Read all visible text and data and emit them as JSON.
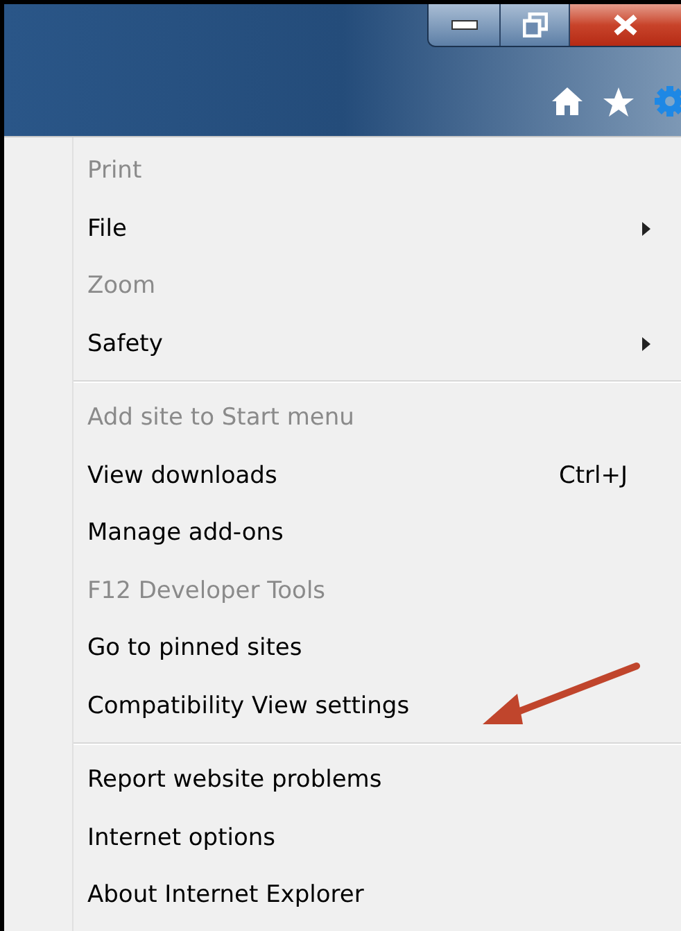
{
  "menu": {
    "sections": [
      {
        "items": [
          {
            "label": "Print",
            "disabled": true,
            "submenu": false
          },
          {
            "label": "File",
            "disabled": false,
            "submenu": true
          },
          {
            "label": "Zoom",
            "disabled": true,
            "submenu": false
          },
          {
            "label": "Safety",
            "disabled": false,
            "submenu": true
          }
        ]
      },
      {
        "items": [
          {
            "label": "Add site to Start menu",
            "disabled": true,
            "submenu": false
          },
          {
            "label": "View downloads",
            "disabled": false,
            "submenu": false,
            "shortcut": "Ctrl+J"
          },
          {
            "label": "Manage add-ons",
            "disabled": false,
            "submenu": false
          },
          {
            "label": "F12 Developer Tools",
            "disabled": true,
            "submenu": false
          },
          {
            "label": "Go to pinned sites",
            "disabled": false,
            "submenu": false
          },
          {
            "label": "Compatibility View settings",
            "disabled": false,
            "submenu": false,
            "annotated": true
          }
        ]
      },
      {
        "items": [
          {
            "label": "Report website problems",
            "disabled": false,
            "submenu": false
          },
          {
            "label": "Internet options",
            "disabled": false,
            "submenu": false
          },
          {
            "label": "About Internet Explorer",
            "disabled": false,
            "submenu": false
          }
        ]
      }
    ]
  }
}
